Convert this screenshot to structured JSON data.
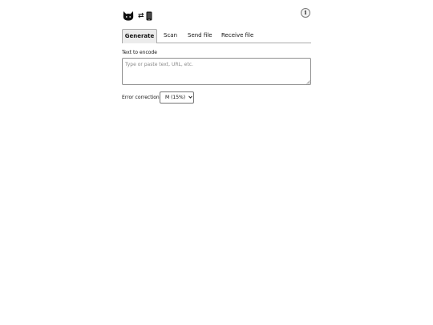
{
  "header": {
    "logo_icons": [
      "cat-face-icon",
      "swap-arrows-icon",
      "mobile-phone-icon"
    ],
    "arrows_glyph": "⇄",
    "info_label": "i"
  },
  "tabs": [
    {
      "label": "Generate",
      "active": true
    },
    {
      "label": "Scan",
      "active": false
    },
    {
      "label": "Send file",
      "active": false
    },
    {
      "label": "Receive file",
      "active": false
    }
  ],
  "generate": {
    "text_label": "Text to encode",
    "text_value": "",
    "text_placeholder": "Type or paste text, URL, etc.",
    "error_correction_label": "Error correction",
    "error_correction_selected": "M (15%)"
  }
}
